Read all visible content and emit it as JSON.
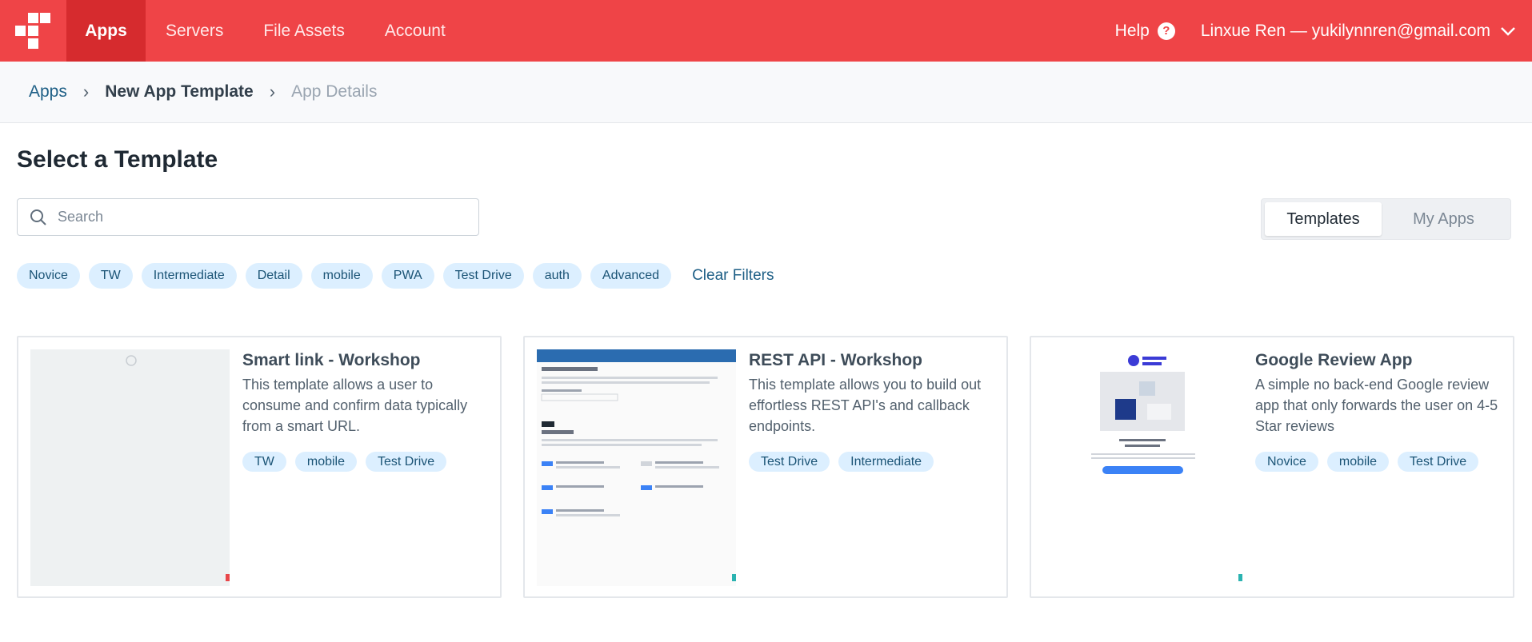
{
  "nav": {
    "items": [
      {
        "label": "Apps",
        "active": true
      },
      {
        "label": "Servers"
      },
      {
        "label": "File Assets"
      },
      {
        "label": "Account"
      }
    ],
    "help_label": "Help",
    "help_icon_glyph": "?",
    "user_label": "Linxue Ren — yukilynnren@gmail.com",
    "brand_color": "#ef4447",
    "active_color": "#d62b2e"
  },
  "breadcrumb": {
    "root": "Apps",
    "current": "New App Template",
    "next": "App Details"
  },
  "page": {
    "title": "Select a Template"
  },
  "search": {
    "placeholder": "Search",
    "value": ""
  },
  "view_toggle": {
    "selected": "Templates",
    "other": "My Apps"
  },
  "filters": {
    "chips": [
      "Novice",
      "TW",
      "Intermediate",
      "Detail",
      "mobile",
      "PWA",
      "Test Drive",
      "auth",
      "Advanced"
    ],
    "clear_label": "Clear Filters"
  },
  "cards": [
    {
      "title": "Smart link - Workshop",
      "description": "This template allows a user to consume and confirm data typically from a smart URL.",
      "tags": [
        "TW",
        "mobile",
        "Test Drive"
      ],
      "thumb_mark_color": "#e8474a"
    },
    {
      "title": "REST API - Workshop",
      "description": "This template allows you to build out effortless REST API's and callback endpoints.",
      "tags": [
        "Test Drive",
        "Intermediate"
      ],
      "thumb_mark_color": "#2bb3b1"
    },
    {
      "title": "Google Review App",
      "description": "A simple no back-end Google review app that only forwards the user on 4-5 Star reviews",
      "tags": [
        "Novice",
        "mobile",
        "Test Drive"
      ],
      "thumb_mark_color": "#2bb3b1"
    }
  ]
}
